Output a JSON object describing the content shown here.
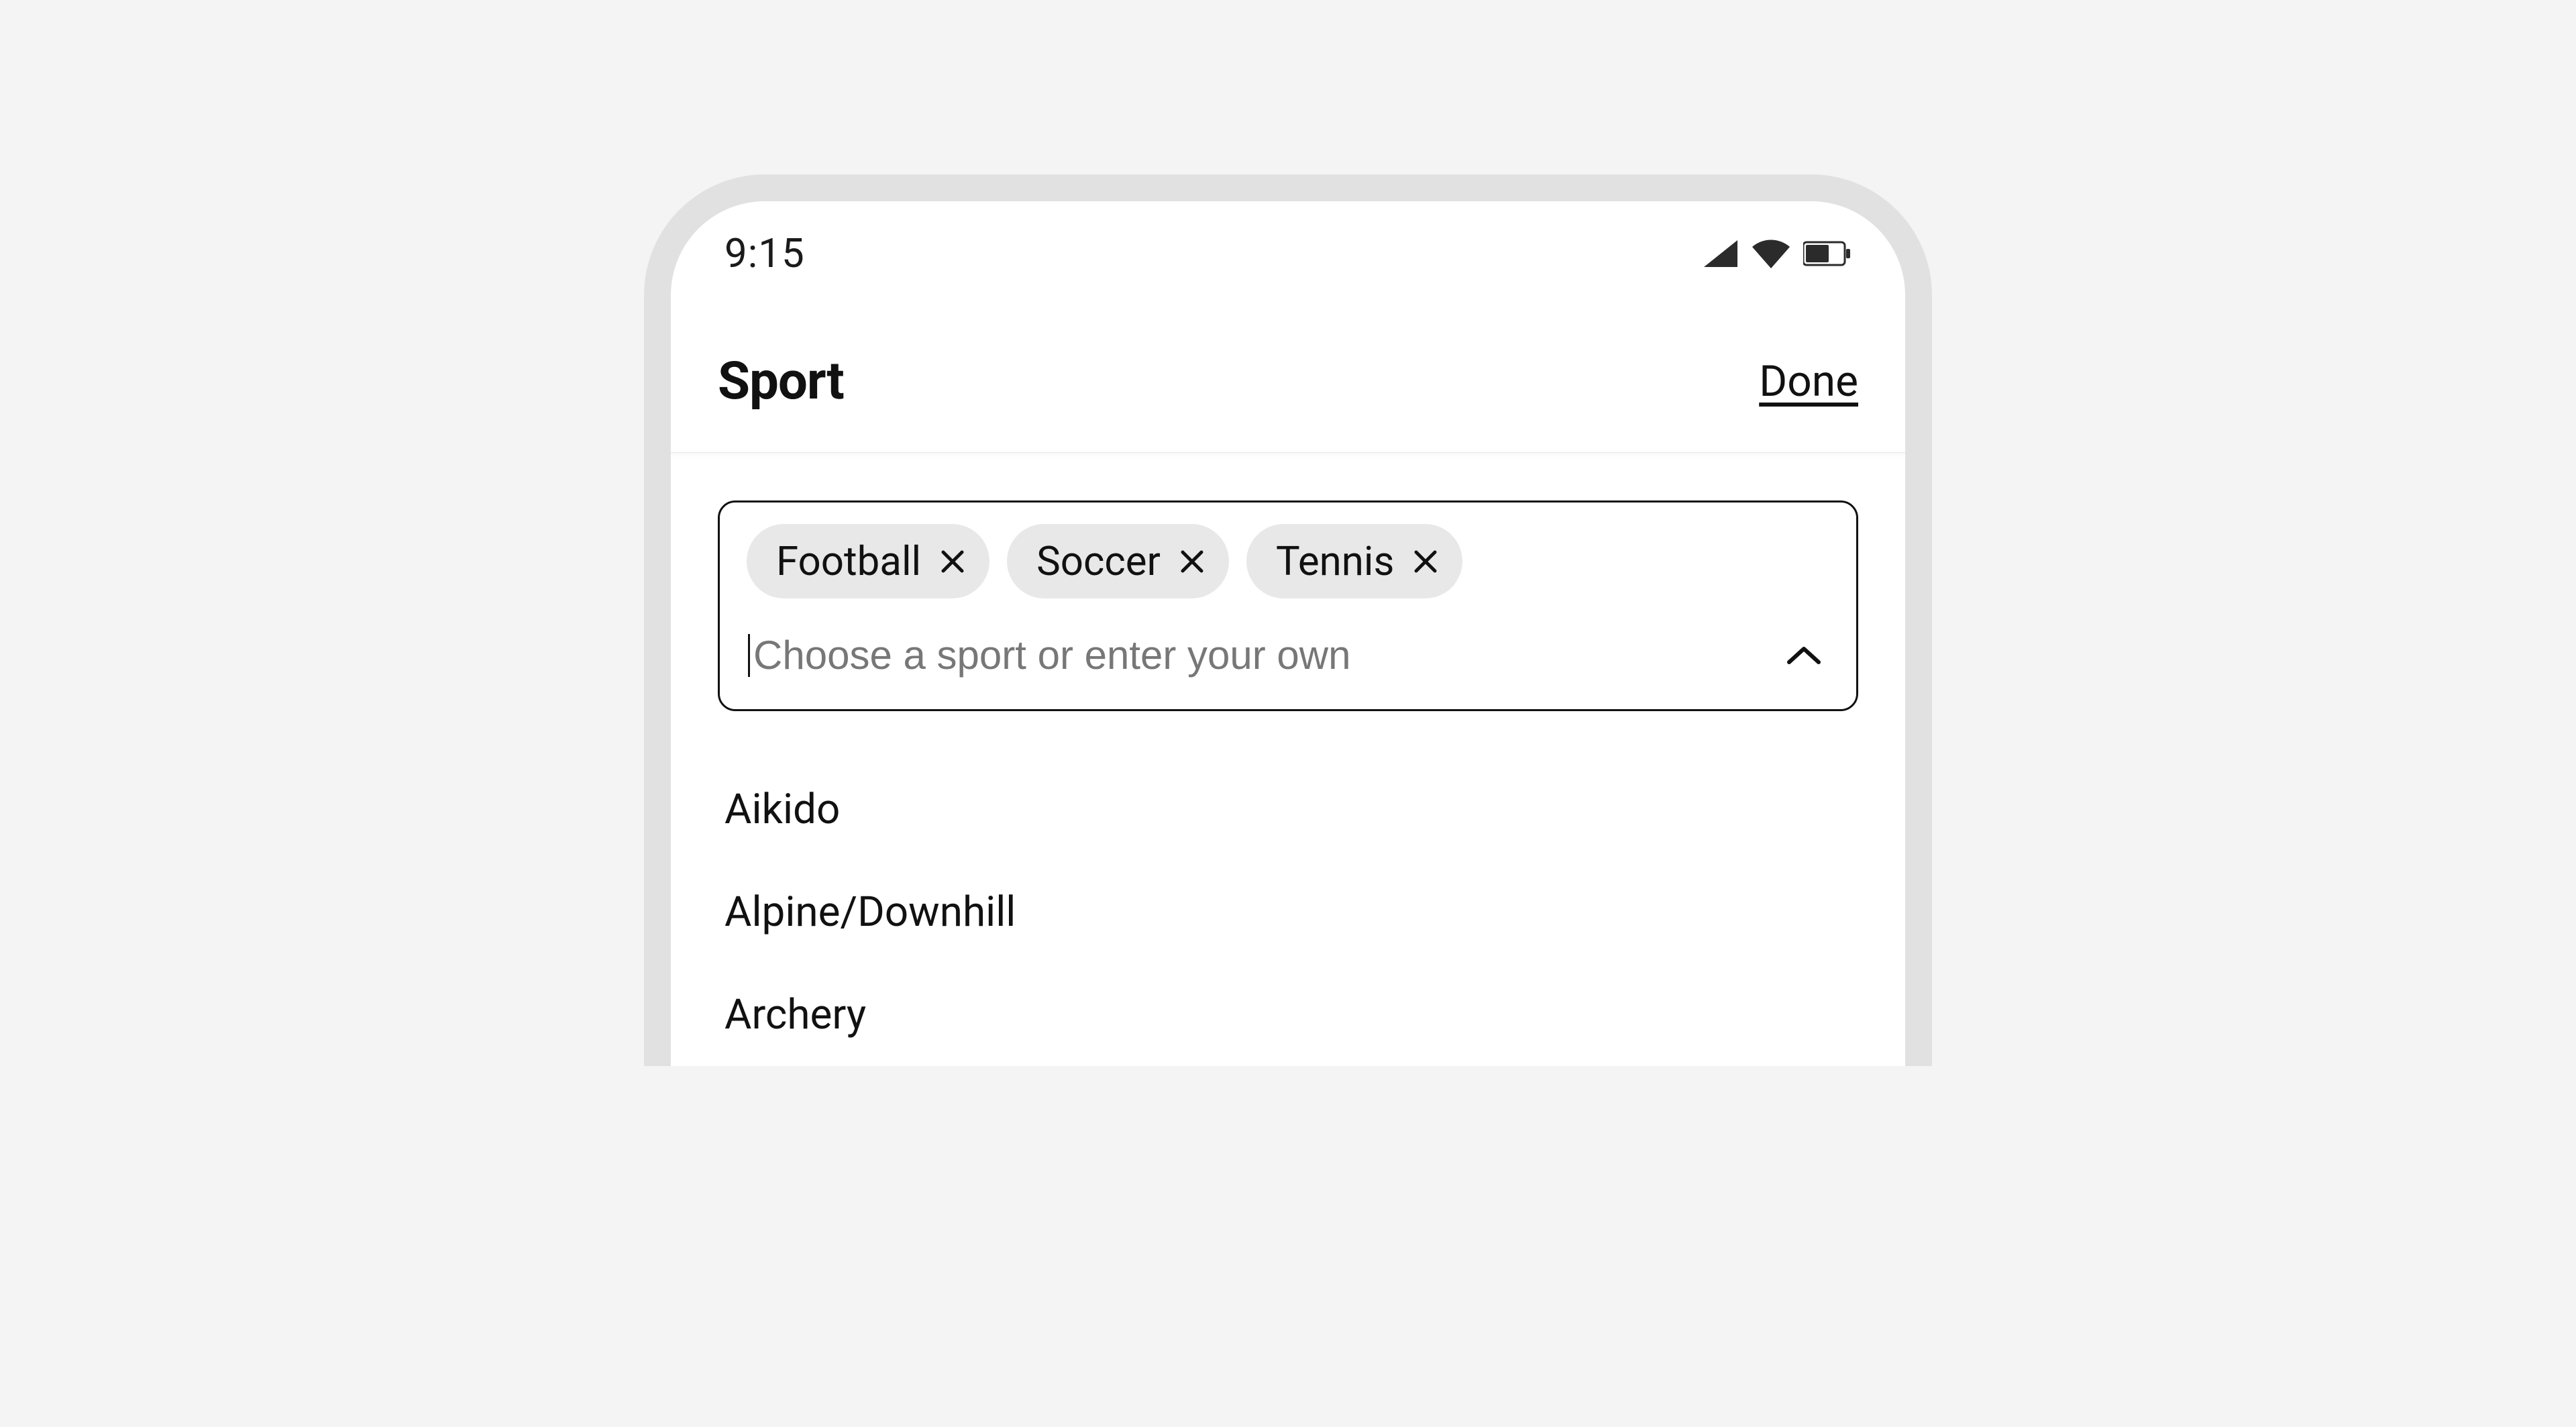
{
  "status": {
    "time": "9:15"
  },
  "header": {
    "title": "Sport",
    "done": "Done"
  },
  "combo": {
    "chips": [
      {
        "label": "Football"
      },
      {
        "label": "Soccer"
      },
      {
        "label": "Tennis"
      }
    ],
    "placeholder": "Choose a sport or enter your own",
    "value": ""
  },
  "options": [
    "Aikido",
    "Alpine/Downhill",
    "Archery"
  ]
}
